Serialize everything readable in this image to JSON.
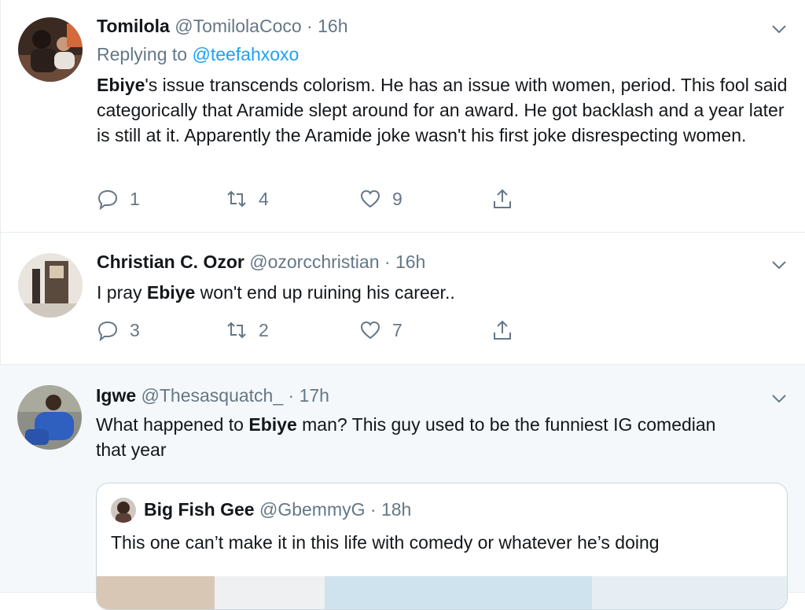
{
  "tweets": [
    {
      "name": "Tomilola",
      "handle": "@TomilolaCoco",
      "time": "16h",
      "replying_label": "Replying to",
      "replying_handle": "@teefahxoxo",
      "bold": "Ebiye",
      "text": "'s issue transcends colorism. He has an issue with women, period. This fool said categorically that Aramide slept around for an award. He got backlash and a year later is still at it. Apparently the Aramide joke wasn't his first joke disrespecting women.",
      "replies": "1",
      "retweets": "4",
      "likes": "9"
    },
    {
      "name": "Christian C. Ozor",
      "handle": "@ozorcchristian",
      "time": "16h",
      "prefix": "I pray ",
      "bold": "Ebiye",
      "text": " won't end up ruining his career..",
      "replies": "3",
      "retweets": "2",
      "likes": "7"
    },
    {
      "name": "Igwe",
      "handle": "@Thesasquatch_",
      "time": "17h",
      "prefix": "What happened to ",
      "bold": "Ebiye",
      "text": " man? This guy used to be the funniest IG comedian that year",
      "quote": {
        "name": "Big Fish Gee",
        "handle": "@GbemmyG",
        "time": "18h",
        "text": "This one can’t make it in this life with comedy or whatever he’s doing"
      }
    }
  ],
  "separator": " · ",
  "colors": {
    "accent": "#1da1f2",
    "muted": "#657786",
    "text": "#14171a",
    "border": "#e6ecf0"
  },
  "icons": [
    "chevron-down-icon",
    "reply-icon",
    "retweet-icon",
    "like-icon",
    "share-icon"
  ]
}
